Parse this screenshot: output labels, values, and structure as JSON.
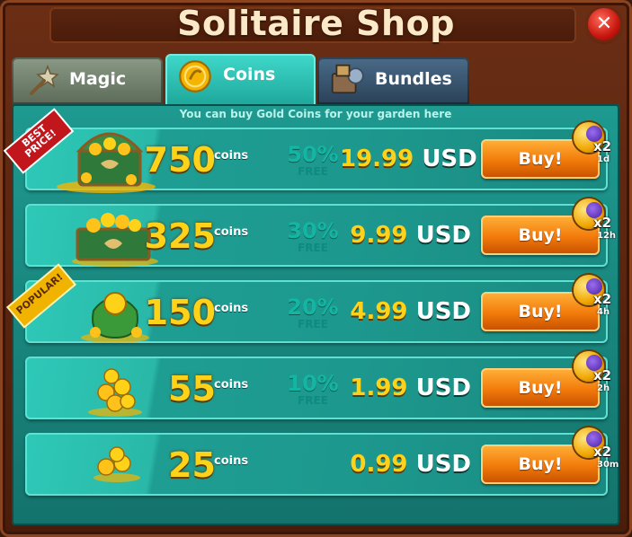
{
  "window": {
    "title": "Solitaire Shop",
    "close_icon": "close-icon"
  },
  "tabs": [
    {
      "label": "Magic",
      "icon": "wand-icon",
      "active": false
    },
    {
      "label": "Coins",
      "icon": "gold-coin-icon",
      "active": true
    },
    {
      "label": "Bundles",
      "icon": "bundle-box-icon",
      "active": false
    }
  ],
  "subtitle": "You can buy Gold Coins for your garden here",
  "colors": {
    "gold": "#ffd21a",
    "panel": "#1e9a90",
    "button": "#f27a0a"
  },
  "offers": [
    {
      "amount": "750",
      "unit": "coins",
      "bonus": "50%",
      "bonus_label": "FREE",
      "price": "19.99",
      "currency": "USD",
      "buy_label": "Buy!",
      "boost_mult": "x2",
      "boost_duration": "1d",
      "badge": "BEST PRICE!",
      "image": "treasure-chest-icon"
    },
    {
      "amount": "325",
      "unit": "coins",
      "bonus": "30%",
      "bonus_label": "FREE",
      "price": "9.99",
      "currency": "USD",
      "buy_label": "Buy!",
      "boost_mult": "x2",
      "boost_duration": "12h",
      "badge": "",
      "image": "coin-box-icon"
    },
    {
      "amount": "150",
      "unit": "coins",
      "bonus": "20%",
      "bonus_label": "FREE",
      "price": "4.99",
      "currency": "USD",
      "buy_label": "Buy!",
      "boost_mult": "x2",
      "boost_duration": "4h",
      "badge": "POPULAR!",
      "image": "coin-bag-icon"
    },
    {
      "amount": "55",
      "unit": "coins",
      "bonus": "10%",
      "bonus_label": "FREE",
      "price": "1.99",
      "currency": "USD",
      "buy_label": "Buy!",
      "boost_mult": "x2",
      "boost_duration": "2h",
      "badge": "",
      "image": "coin-stack-icon"
    },
    {
      "amount": "25",
      "unit": "coins",
      "bonus": "",
      "bonus_label": "",
      "price": "0.99",
      "currency": "USD",
      "buy_label": "Buy!",
      "boost_mult": "x2",
      "boost_duration": "30m",
      "badge": "",
      "image": "coin-pile-icon"
    }
  ]
}
